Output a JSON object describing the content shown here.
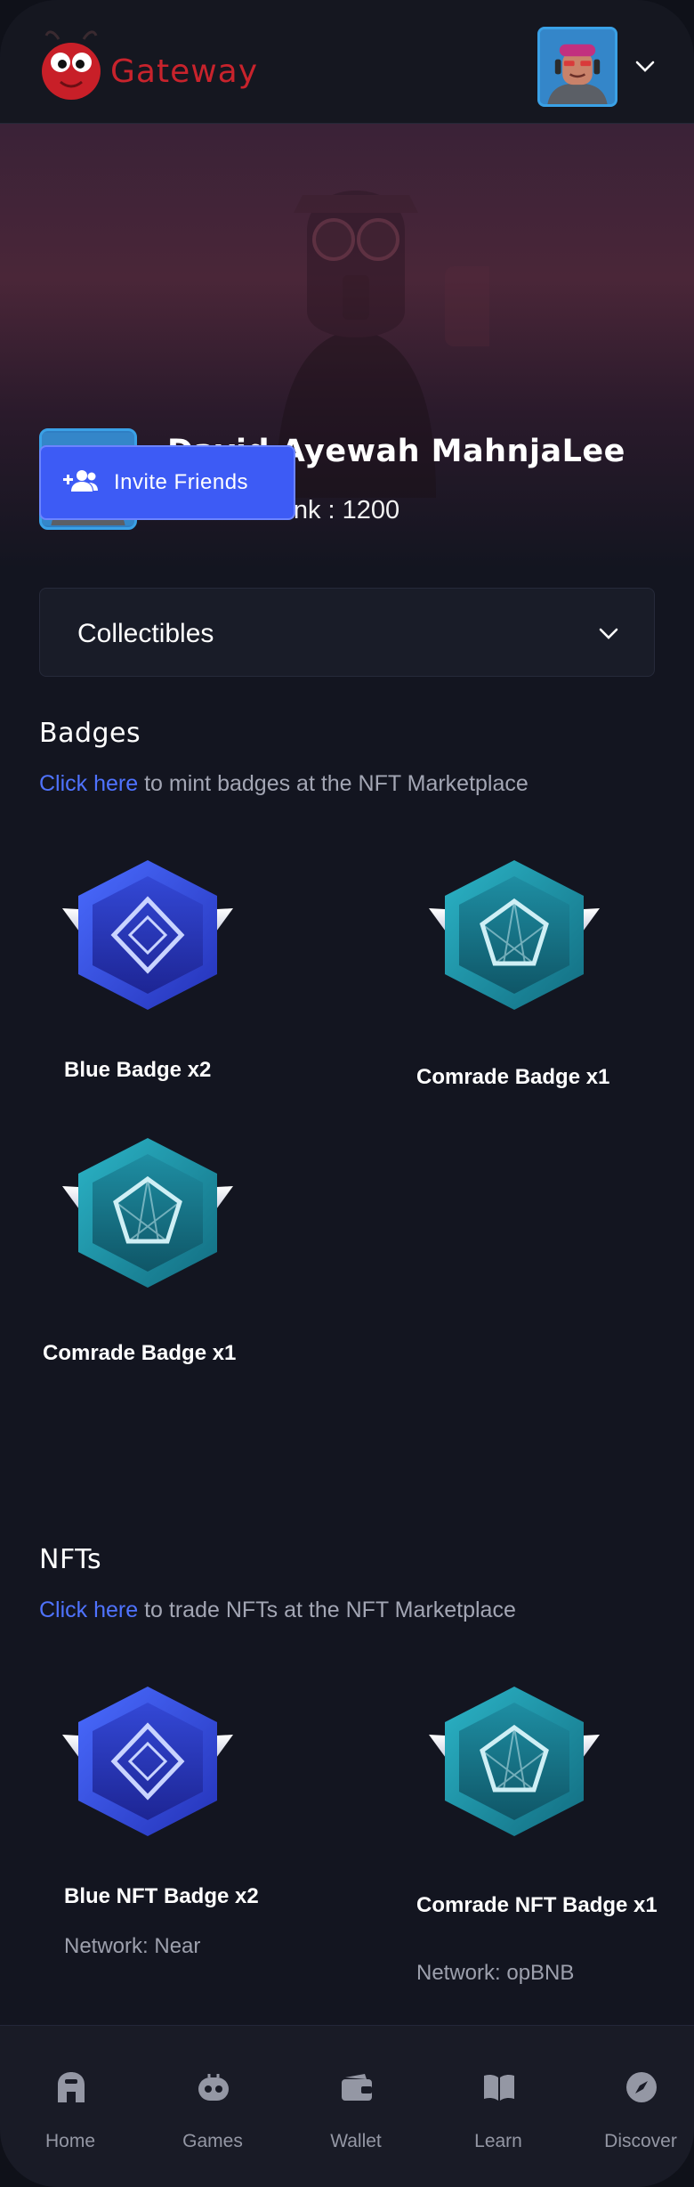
{
  "app": {
    "name": "Gateway"
  },
  "header": {
    "avatar_icon": "user-avatar",
    "menu_icon": "chevron-down-icon"
  },
  "profile": {
    "name": "David Ayewah MahnjaLee",
    "rank": "Current Rank : 1200",
    "invite_label": "Invite Friends",
    "invite_icon": "add-user-icon"
  },
  "collection_select": {
    "selected": "Collectibles"
  },
  "badges": {
    "title": "Badges",
    "link_text": "Click here",
    "sub_text": " to mint badges at the NFT Marketplace",
    "items": [
      {
        "label": "Blue Badge x2",
        "type": "blue"
      },
      {
        "label": "Comrade Badge x1",
        "type": "teal"
      },
      {
        "label": "Comrade Badge x1",
        "type": "teal"
      }
    ]
  },
  "nfts": {
    "title": "NFTs",
    "link_text": "Click here",
    "sub_text": " to trade NFTs at the NFT Marketplace",
    "items": [
      {
        "label": "Blue NFT Badge x2",
        "network": "Network: Near",
        "type": "blue"
      },
      {
        "label": "Comrade NFT Badge x1",
        "network": "Network: opBNB",
        "type": "teal"
      }
    ]
  },
  "nav": [
    {
      "label": "Home",
      "icon": "home-icon"
    },
    {
      "label": "Games",
      "icon": "gamepad-icon"
    },
    {
      "label": "Wallet",
      "icon": "wallet-icon"
    },
    {
      "label": "Learn",
      "icon": "book-icon"
    },
    {
      "label": "Discover",
      "icon": "compass-icon"
    }
  ],
  "colors": {
    "accent": "#3d5bf5",
    "link": "#4f73ff",
    "brand": "#c8232c",
    "background": "#131520"
  }
}
